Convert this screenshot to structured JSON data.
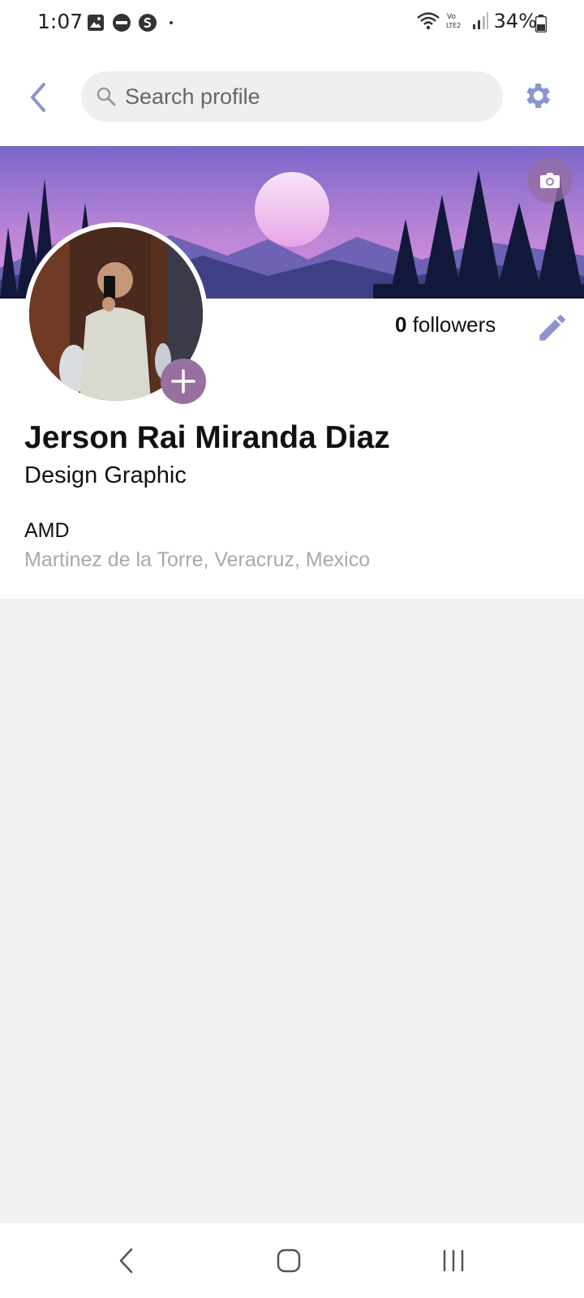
{
  "status_bar": {
    "time": "1:07",
    "battery": "34%",
    "icons": [
      "gallery-icon",
      "app-badge-icon",
      "skype-icon",
      "dot-icon",
      "wifi-icon",
      "volte-icon",
      "signal-icon",
      "battery-icon"
    ]
  },
  "app_bar": {
    "search_placeholder": "Search profile",
    "accent_color": "#8d95cf"
  },
  "profile": {
    "followers_count": "0",
    "followers_label": " followers",
    "name": "Jerson Rai Miranda Diaz",
    "title": "Design Graphic",
    "company": "AMD",
    "location": "Martinez de la Torre, Veracruz, Mexico",
    "add_button_color": "#98709f"
  }
}
